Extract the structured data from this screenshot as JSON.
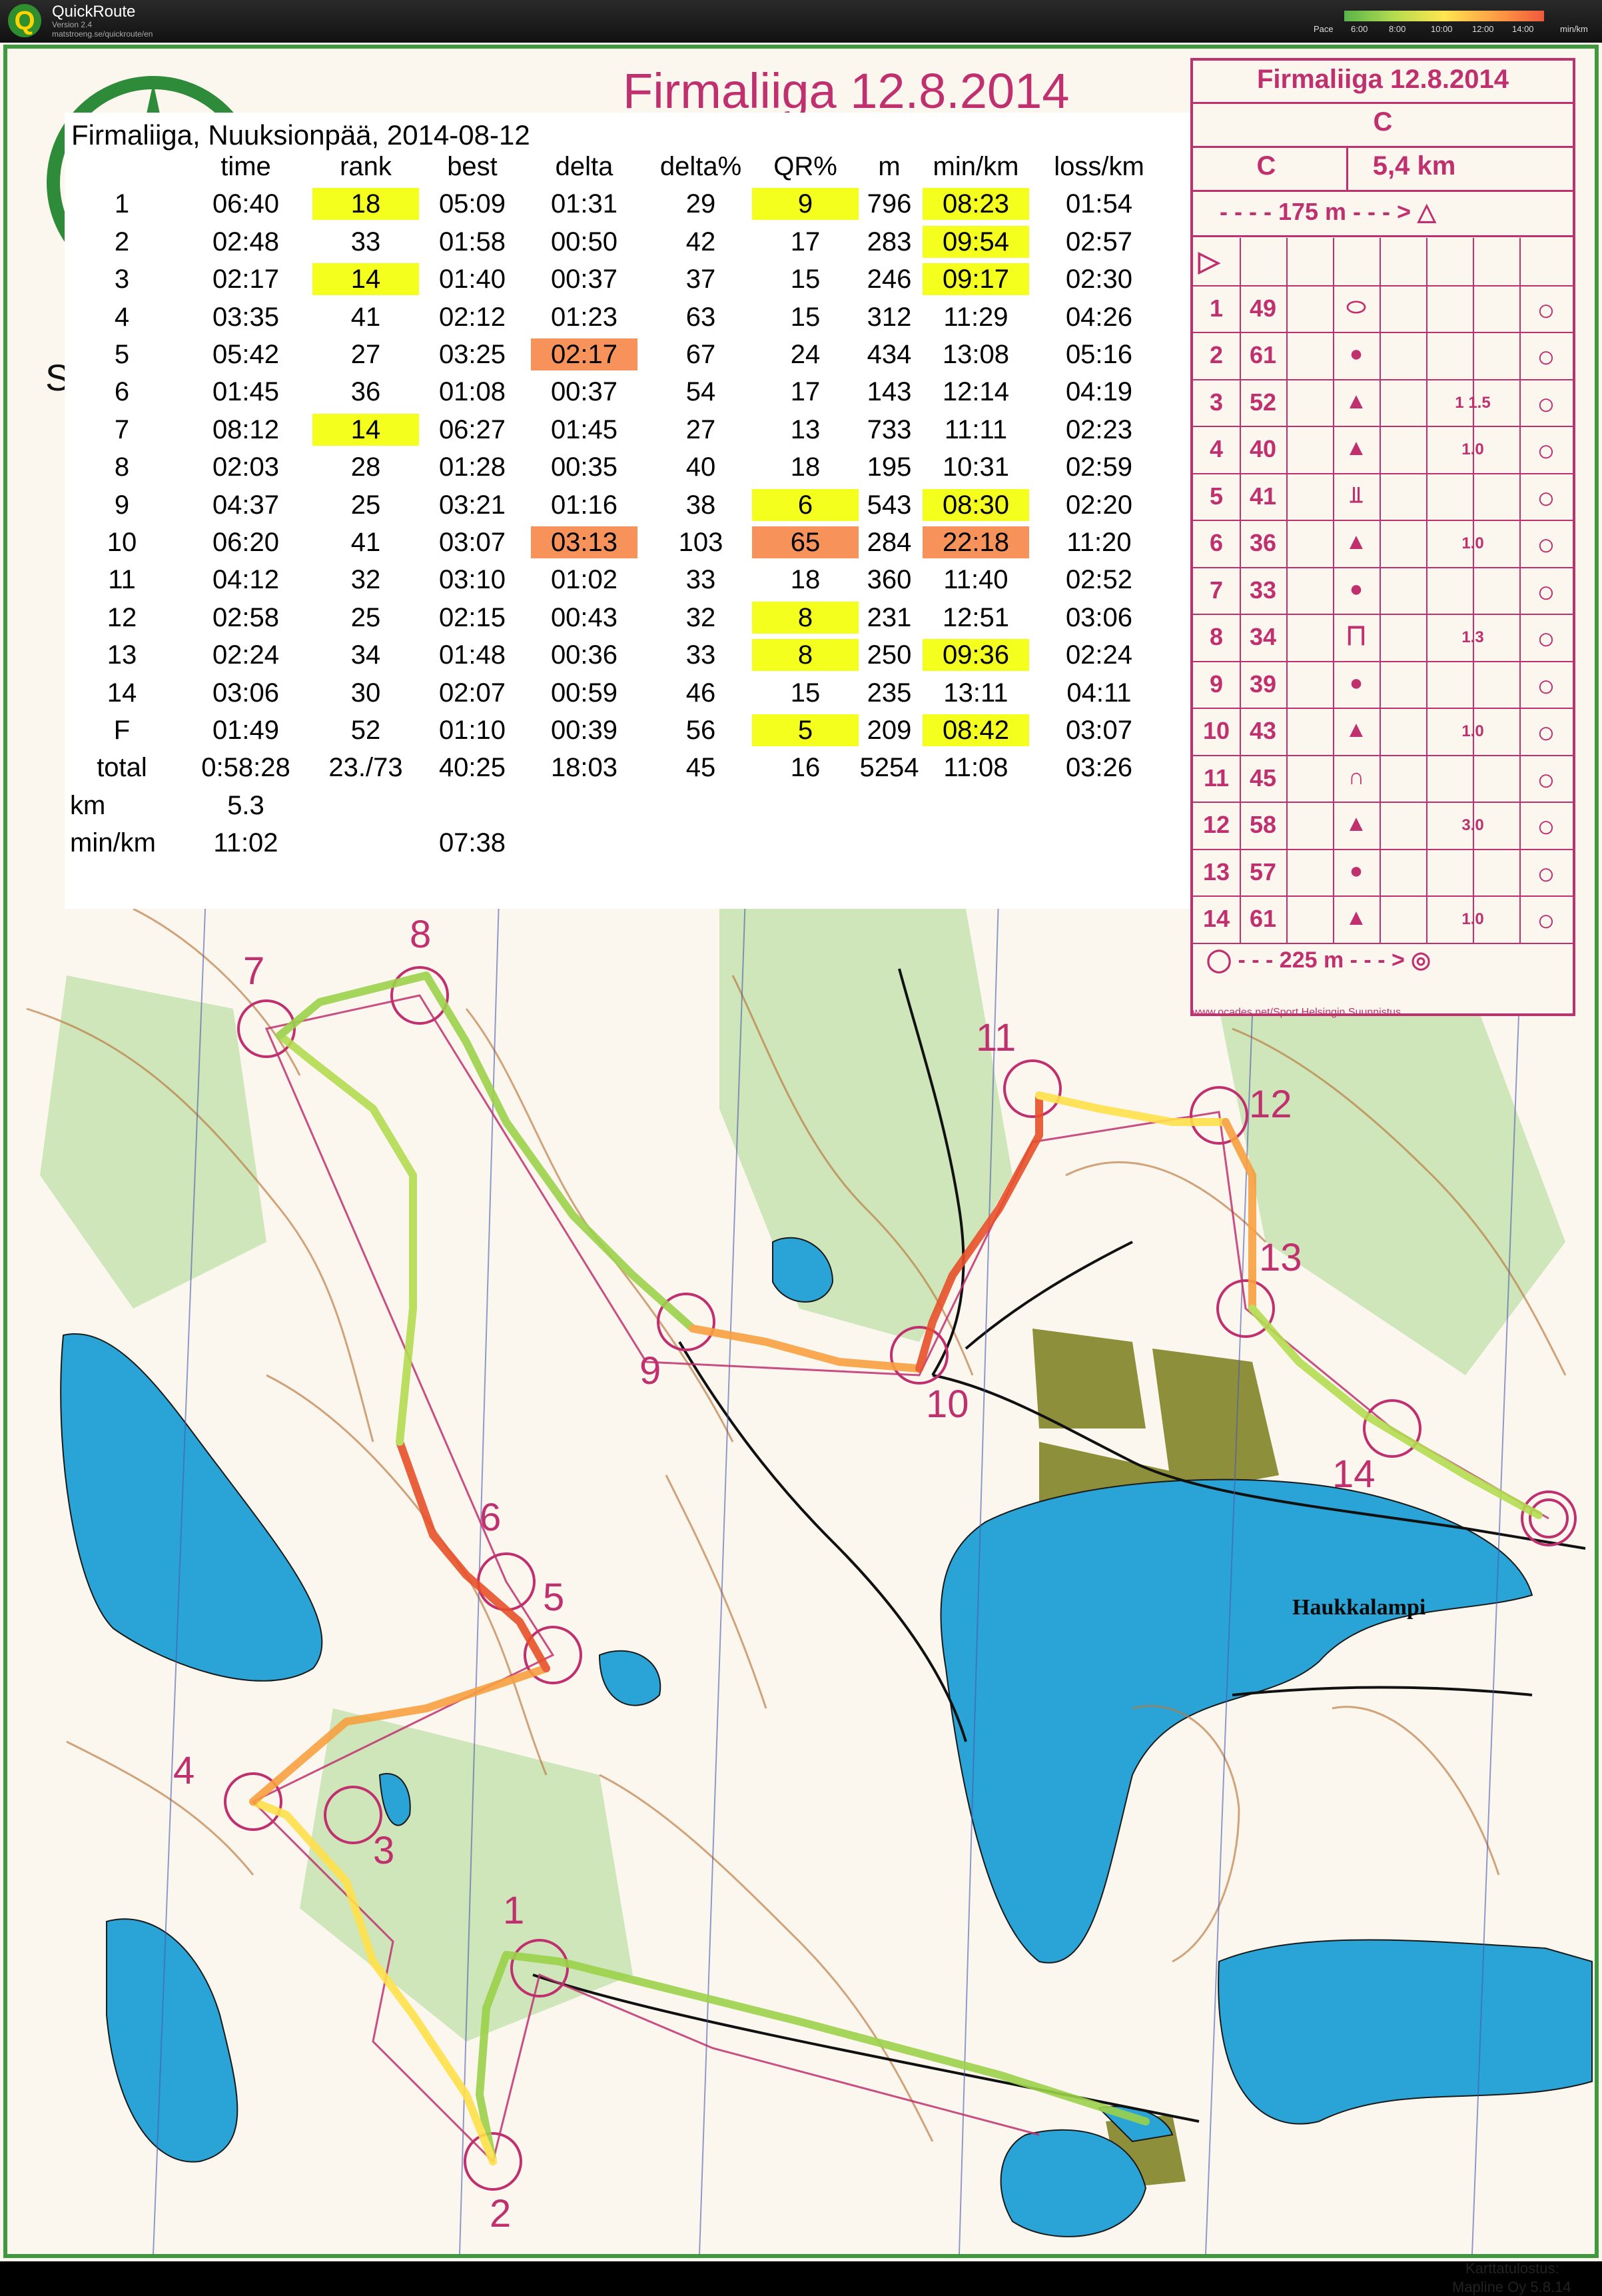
{
  "app": {
    "name": "QuickRoute",
    "version": "Version 2.4",
    "url": "matstroeng.se/quickroute/en",
    "pace_label": "Pace",
    "pace_ticks": [
      "6:00",
      "8:00",
      "10:00",
      "12:00",
      "14:00"
    ],
    "pace_unit": "min/km"
  },
  "map": {
    "event_title": "Firmaliiga 12.8.2014",
    "lake_label": "Haukkalampi",
    "printer_line1": "Karttatulostus:",
    "printer_line2": "Mapline Oy  5.8.14",
    "edge_letter": "S",
    "route_color_slow": "#e0451f",
    "route_color_fast": "#6cb43c",
    "course_color": "#c0306e",
    "water_color": "#2aa4d6",
    "vegetation_color": "#c9e3b4",
    "control_numbers": [
      "1",
      "2",
      "3",
      "4",
      "5",
      "6",
      "7",
      "8",
      "9",
      "10",
      "11",
      "12",
      "13",
      "14"
    ]
  },
  "splits": {
    "title": "Firmaliiga, Nuuksionpää, 2014-08-12",
    "columns": [
      "",
      "time",
      "rank",
      "best",
      "delta",
      "delta%",
      "QR%",
      "m",
      "min/km",
      "loss/km"
    ],
    "rows": [
      [
        "1",
        "06:40",
        "18",
        "05:09",
        "01:31",
        "29",
        "9",
        "796",
        "08:23",
        "01:54"
      ],
      [
        "2",
        "02:48",
        "33",
        "01:58",
        "00:50",
        "42",
        "17",
        "283",
        "09:54",
        "02:57"
      ],
      [
        "3",
        "02:17",
        "14",
        "01:40",
        "00:37",
        "37",
        "15",
        "246",
        "09:17",
        "02:30"
      ],
      [
        "4",
        "03:35",
        "41",
        "02:12",
        "01:23",
        "63",
        "15",
        "312",
        "11:29",
        "04:26"
      ],
      [
        "5",
        "05:42",
        "27",
        "03:25",
        "02:17",
        "67",
        "24",
        "434",
        "13:08",
        "05:16"
      ],
      [
        "6",
        "01:45",
        "36",
        "01:08",
        "00:37",
        "54",
        "17",
        "143",
        "12:14",
        "04:19"
      ],
      [
        "7",
        "08:12",
        "14",
        "06:27",
        "01:45",
        "27",
        "13",
        "733",
        "11:11",
        "02:23"
      ],
      [
        "8",
        "02:03",
        "28",
        "01:28",
        "00:35",
        "40",
        "18",
        "195",
        "10:31",
        "02:59"
      ],
      [
        "9",
        "04:37",
        "25",
        "03:21",
        "01:16",
        "38",
        "6",
        "543",
        "08:30",
        "02:20"
      ],
      [
        "10",
        "06:20",
        "41",
        "03:07",
        "03:13",
        "103",
        "65",
        "284",
        "22:18",
        "11:20"
      ],
      [
        "11",
        "04:12",
        "32",
        "03:10",
        "01:02",
        "33",
        "18",
        "360",
        "11:40",
        "02:52"
      ],
      [
        "12",
        "02:58",
        "25",
        "02:15",
        "00:43",
        "32",
        "8",
        "231",
        "12:51",
        "03:06"
      ],
      [
        "13",
        "02:24",
        "34",
        "01:48",
        "00:36",
        "33",
        "8",
        "250",
        "09:36",
        "02:24"
      ],
      [
        "14",
        "03:06",
        "30",
        "02:07",
        "00:59",
        "46",
        "15",
        "235",
        "13:11",
        "04:11"
      ],
      [
        "F",
        "01:49",
        "52",
        "01:10",
        "00:39",
        "56",
        "5",
        "209",
        "08:42",
        "03:07"
      ],
      [
        "total",
        "0:58:28",
        "23./73",
        "40:25",
        "18:03",
        "45",
        "16",
        "5254",
        "11:08",
        "03:26"
      ]
    ],
    "highlights": [
      {
        "row": 0,
        "col": 2,
        "color": "yellow"
      },
      {
        "row": 0,
        "col": 6,
        "color": "yellow"
      },
      {
        "row": 0,
        "col": 8,
        "color": "yellow"
      },
      {
        "row": 1,
        "col": 8,
        "color": "yellow"
      },
      {
        "row": 2,
        "col": 2,
        "color": "yellow"
      },
      {
        "row": 2,
        "col": 8,
        "color": "yellow"
      },
      {
        "row": 4,
        "col": 4,
        "color": "orange"
      },
      {
        "row": 6,
        "col": 2,
        "color": "yellow"
      },
      {
        "row": 8,
        "col": 6,
        "color": "yellow"
      },
      {
        "row": 8,
        "col": 8,
        "color": "yellow"
      },
      {
        "row": 9,
        "col": 4,
        "color": "orange"
      },
      {
        "row": 9,
        "col": 6,
        "color": "orange"
      },
      {
        "row": 9,
        "col": 8,
        "color": "orange"
      },
      {
        "row": 11,
        "col": 6,
        "color": "yellow"
      },
      {
        "row": 12,
        "col": 6,
        "color": "yellow"
      },
      {
        "row": 12,
        "col": 8,
        "color": "yellow"
      },
      {
        "row": 14,
        "col": 6,
        "color": "yellow"
      },
      {
        "row": 14,
        "col": 8,
        "color": "yellow"
      }
    ],
    "footer": [
      [
        "km",
        "5.3",
        ""
      ],
      [
        "min/km",
        "11:02",
        "07:38"
      ]
    ]
  },
  "control_descriptions": {
    "title": "Firmaliiga 12.8.2014",
    "class": "C",
    "course": "C",
    "length": "5,4 km",
    "climb": "175 m",
    "finish_dist": "225 m",
    "url": "www.ocades.net/Sport Helsingin Suunnistus",
    "controls": [
      {
        "n": "1",
        "code": "49",
        "dim": ""
      },
      {
        "n": "2",
        "code": "61",
        "dim": ""
      },
      {
        "n": "3",
        "code": "52",
        "dim": "1 1.5"
      },
      {
        "n": "4",
        "code": "40",
        "dim": "1.0"
      },
      {
        "n": "5",
        "code": "41",
        "dim": ""
      },
      {
        "n": "6",
        "code": "36",
        "dim": "1.0"
      },
      {
        "n": "7",
        "code": "33",
        "dim": ""
      },
      {
        "n": "8",
        "code": "34",
        "dim": "1.3"
      },
      {
        "n": "9",
        "code": "39",
        "dim": ""
      },
      {
        "n": "10",
        "code": "43",
        "dim": "1.0"
      },
      {
        "n": "11",
        "code": "45",
        "dim": ""
      },
      {
        "n": "12",
        "code": "58",
        "dim": "3.0"
      },
      {
        "n": "13",
        "code": "57",
        "dim": ""
      },
      {
        "n": "14",
        "code": "61",
        "dim": "1.0"
      }
    ]
  }
}
